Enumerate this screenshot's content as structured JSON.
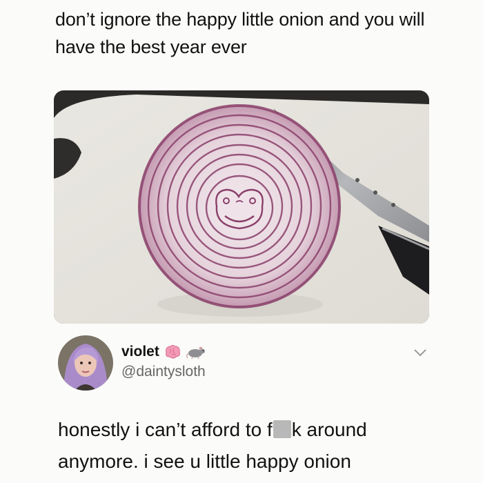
{
  "post": {
    "caption": "don’t ignore the happy little onion and you will have the best year ever",
    "image_icon": "onion-photo-icon"
  },
  "reply": {
    "display_name": "violet",
    "name_emojis": [
      "brain-emoji-icon",
      "rat-emoji-icon"
    ],
    "handle": "@daintysloth",
    "text_before": "honestly i can’t afford to f",
    "censored_icon": "censor-block-icon",
    "text_after": "k around anymore. i see u little happy onion",
    "menu_icon": "chevron-down-icon"
  },
  "colors": {
    "background": "#fbfbf9",
    "text": "#111111",
    "handle": "#666666",
    "onion_purple": "#8a3f6a"
  }
}
